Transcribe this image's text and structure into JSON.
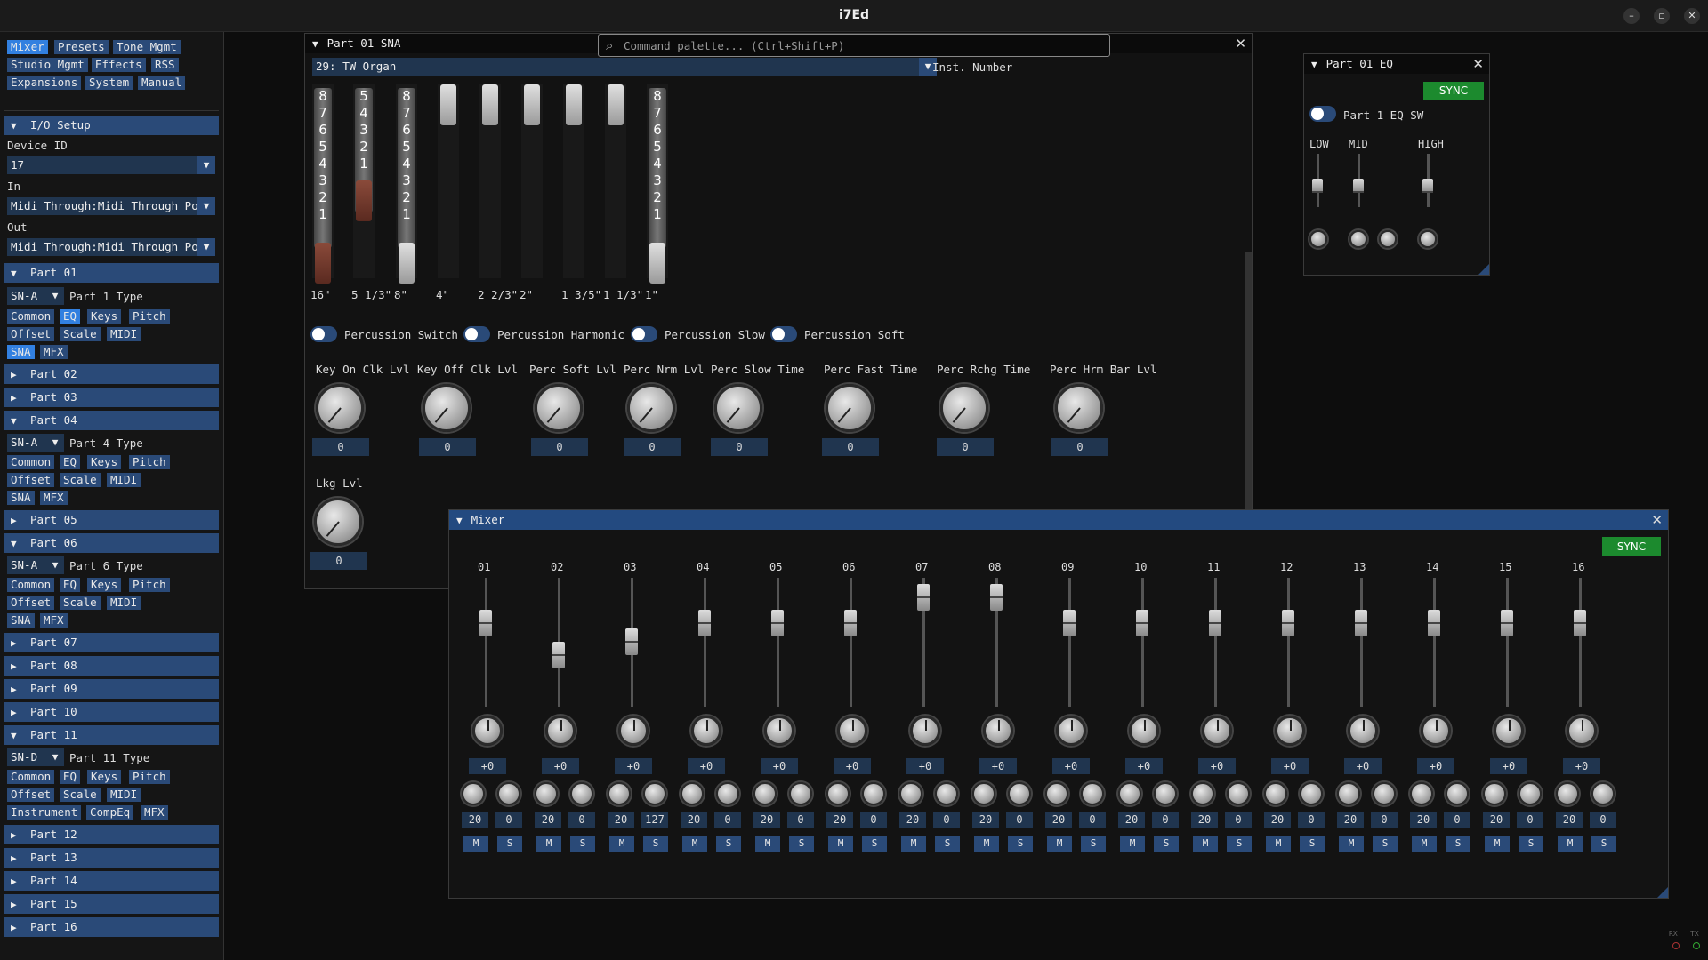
{
  "app": {
    "title": "i7Ed",
    "win_min": "–",
    "win_max": "▫",
    "win_close": "✕"
  },
  "nav": [
    "Mixer",
    "Presets",
    "Tone Mgmt",
    "Studio Mgmt",
    "Effects",
    "RSS",
    "Expansions",
    "System",
    "Manual"
  ],
  "io": {
    "header": "I/O Setup",
    "device_label": "Device ID",
    "device_value": "17",
    "in_label": "In",
    "in_value": "Midi Through:Midi Through Port",
    "out_label": "Out",
    "out_value": "Midi Through:Midi Through Port"
  },
  "parts": {
    "p01": {
      "header": "Part 01",
      "type_value": "SN-A",
      "type_label": "Part 1 Type",
      "buttons": [
        "Common",
        "EQ",
        "Keys",
        "Pitch",
        "Offset",
        "Scale",
        "MIDI",
        "SNA",
        "MFX"
      ]
    },
    "p02": "Part 02",
    "p03": "Part 03",
    "p04": {
      "header": "Part 04",
      "type_value": "SN-A",
      "type_label": "Part 4 Type",
      "buttons": [
        "Common",
        "EQ",
        "Keys",
        "Pitch",
        "Offset",
        "Scale",
        "MIDI",
        "SNA",
        "MFX"
      ]
    },
    "p05": "Part 05",
    "p06": {
      "header": "Part 06",
      "type_value": "SN-A",
      "type_label": "Part 6 Type",
      "buttons": [
        "Common",
        "EQ",
        "Keys",
        "Pitch",
        "Offset",
        "Scale",
        "MIDI",
        "SNA",
        "MFX"
      ]
    },
    "p07": "Part 07",
    "p08": "Part 08",
    "p09": "Part 09",
    "p10": "Part 10",
    "p11": {
      "header": "Part 11",
      "type_value": "SN-D",
      "type_label": "Part 11 Type",
      "buttons": [
        "Common",
        "EQ",
        "Keys",
        "Pitch",
        "Offset",
        "Scale",
        "MIDI",
        "Instrument",
        "CompEq",
        "MFX"
      ]
    },
    "p12": "Part 12",
    "p13": "Part 13",
    "p14": "Part 14",
    "p15": "Part 15",
    "p16": "Part 16"
  },
  "sna": {
    "title": "Part 01 SNA",
    "inst_value": "29: TW Organ",
    "inst_label": "Inst. Number",
    "drawbar_labels": [
      "16\"",
      "5 1/3\"",
      "8\"",
      "4\"",
      "2 2/3\"",
      "2\"",
      "1 3/5\"",
      "1 1/3\"",
      "1\""
    ],
    "drawbar_levels": [
      1,
      2,
      1,
      8,
      8,
      8,
      8,
      8,
      1
    ],
    "switches": [
      "Percussion Switch",
      "Percussion Harmonic",
      "Percussion Slow",
      "Percussion Soft"
    ],
    "knobs": [
      {
        "label": "Key On Clk Lvl",
        "value": "0"
      },
      {
        "label": "Key Off Clk Lvl",
        "value": "0"
      },
      {
        "label": "Perc Soft Lvl",
        "value": "0"
      },
      {
        "label": "Perc Nrm Lvl",
        "value": "0"
      },
      {
        "label": "Perc Slow Time",
        "value": "0"
      },
      {
        "label": "Perc Fast Time",
        "value": "0"
      },
      {
        "label": "Perc Rchg Time",
        "value": "0"
      },
      {
        "label": "Perc Hrm Bar Lvl",
        "value": "0"
      },
      {
        "label": "Lkg Lvl",
        "value": "0"
      }
    ]
  },
  "palette": {
    "placeholder": "Command palette...  (Ctrl+Shift+P)"
  },
  "eq": {
    "title": "Part 01 EQ",
    "sync": "SYNC",
    "switch_label": "Part 1 EQ SW",
    "low": "LOW",
    "mid": "MID",
    "high": "HIGH"
  },
  "mixer": {
    "title": "Mixer",
    "sync": "SYNC",
    "channels": [
      {
        "n": "01",
        "fader": 0.7,
        "pan": "+0",
        "a": "20",
        "b": "0"
      },
      {
        "n": "02",
        "fader": 0.45,
        "pan": "+0",
        "a": "20",
        "b": "0"
      },
      {
        "n": "03",
        "fader": 0.55,
        "pan": "+0",
        "a": "20",
        "b": "127"
      },
      {
        "n": "04",
        "fader": 0.7,
        "pan": "+0",
        "a": "20",
        "b": "0"
      },
      {
        "n": "05",
        "fader": 0.7,
        "pan": "+0",
        "a": "20",
        "b": "0"
      },
      {
        "n": "06",
        "fader": 0.7,
        "pan": "+0",
        "a": "20",
        "b": "0"
      },
      {
        "n": "07",
        "fader": 0.9,
        "pan": "+0",
        "a": "20",
        "b": "0"
      },
      {
        "n": "08",
        "fader": 0.9,
        "pan": "+0",
        "a": "20",
        "b": "0"
      },
      {
        "n": "09",
        "fader": 0.7,
        "pan": "+0",
        "a": "20",
        "b": "0"
      },
      {
        "n": "10",
        "fader": 0.7,
        "pan": "+0",
        "a": "20",
        "b": "0"
      },
      {
        "n": "11",
        "fader": 0.7,
        "pan": "+0",
        "a": "20",
        "b": "0"
      },
      {
        "n": "12",
        "fader": 0.7,
        "pan": "+0",
        "a": "20",
        "b": "0"
      },
      {
        "n": "13",
        "fader": 0.7,
        "pan": "+0",
        "a": "20",
        "b": "0"
      },
      {
        "n": "14",
        "fader": 0.7,
        "pan": "+0",
        "a": "20",
        "b": "0"
      },
      {
        "n": "15",
        "fader": 0.7,
        "pan": "+0",
        "a": "20",
        "b": "0"
      },
      {
        "n": "16",
        "fader": 0.7,
        "pan": "+0",
        "a": "20",
        "b": "0"
      }
    ],
    "mute": "M",
    "solo": "S"
  },
  "status": {
    "rx": "RX",
    "tx": "TX"
  }
}
